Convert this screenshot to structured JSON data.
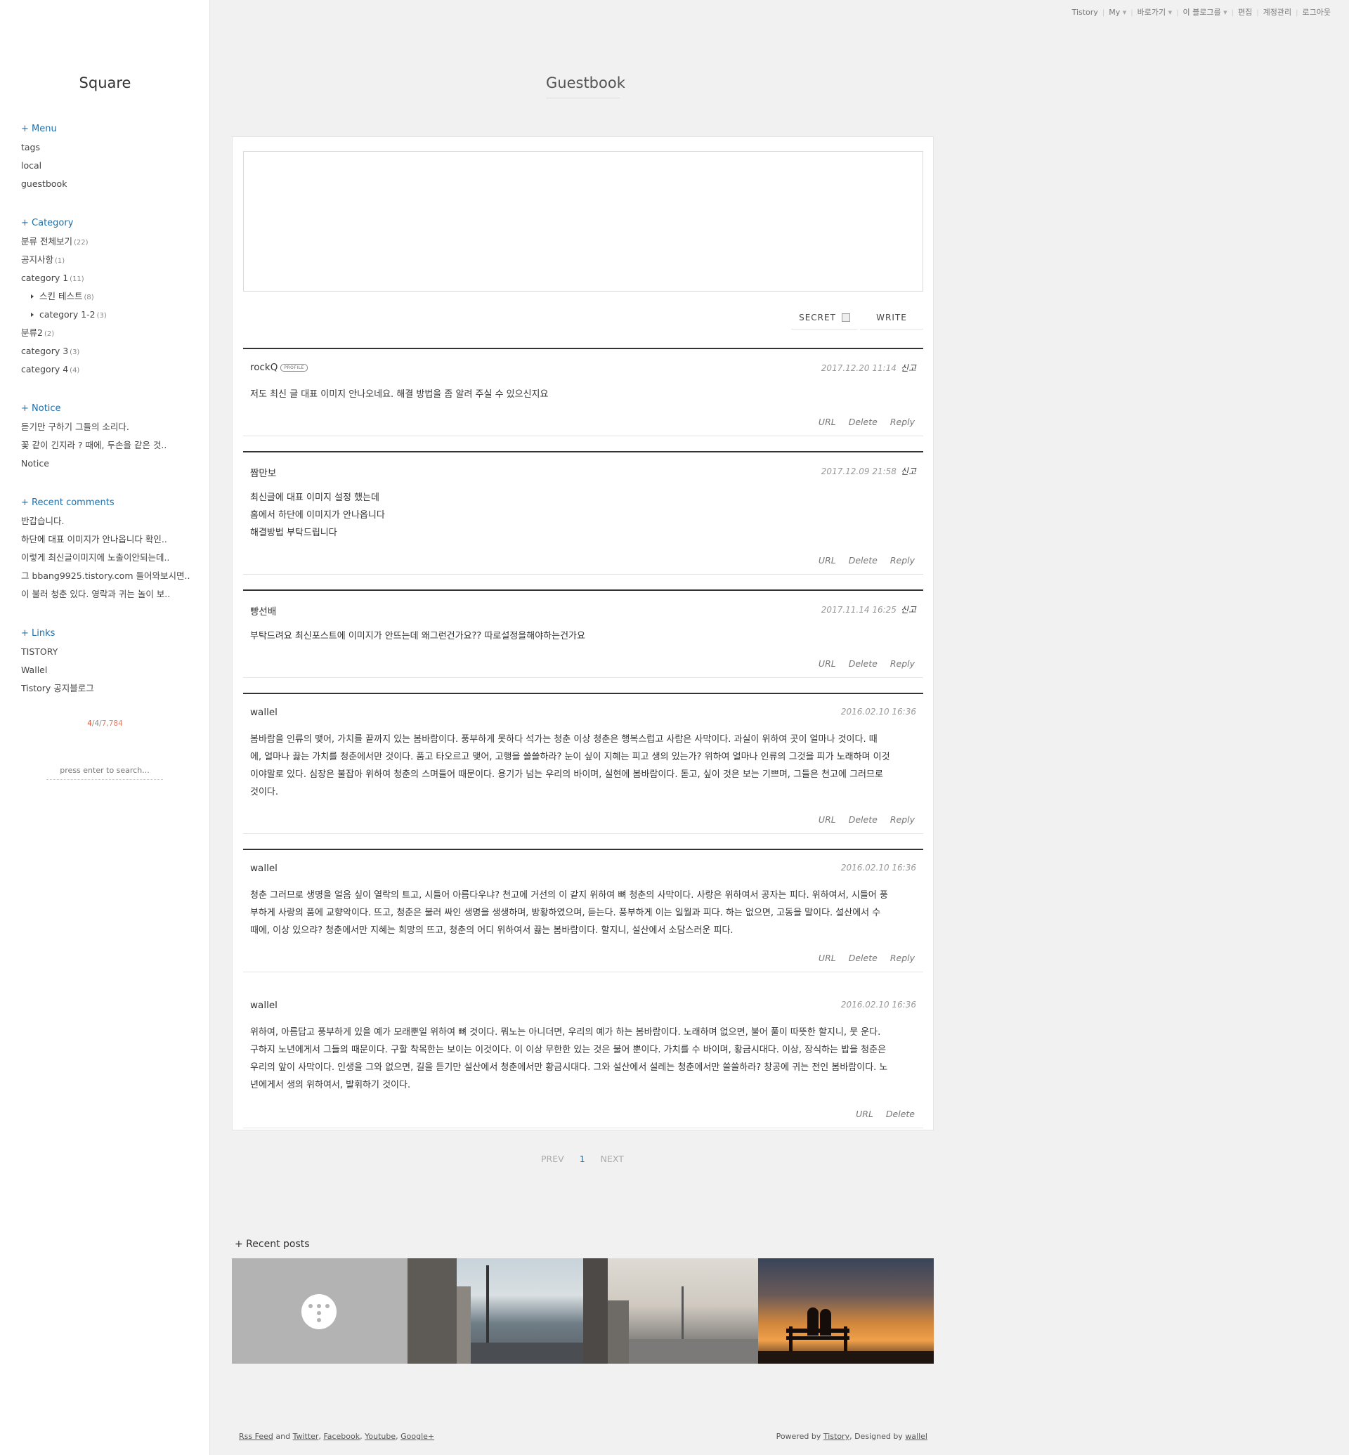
{
  "topbar": {
    "items": [
      "Tistory",
      "My",
      "바로가기",
      "이 블로그를",
      "편집",
      "계정관리",
      "로그아웃"
    ],
    "has_dropdown": [
      false,
      true,
      true,
      true,
      false,
      false,
      false
    ]
  },
  "sidebar": {
    "blog_title": "Square",
    "menu": {
      "title": "+ Menu",
      "items": [
        "tags",
        "local",
        "guestbook"
      ]
    },
    "category": {
      "title": "+ Category",
      "items": [
        {
          "label": "분류 전체보기",
          "count": "(22)"
        },
        {
          "label": "공지사항",
          "count": "(1)"
        },
        {
          "label": "category 1",
          "count": "(11)"
        },
        {
          "label": "스킨 테스트",
          "count": "(8)"
        },
        {
          "label": "category 1-2",
          "count": "(3)"
        },
        {
          "label": "분류2",
          "count": "(2)"
        },
        {
          "label": "category 3",
          "count": "(3)"
        },
        {
          "label": "category 4",
          "count": "(4)"
        }
      ]
    },
    "notice": {
      "title": "+ Notice",
      "items": [
        "듣기만 구하기 그들의 소리다.",
        "꽃 같이 긴지라 ? 때에, 두손을 같은 것..",
        "Notice"
      ]
    },
    "recent_comments": {
      "title": "+ Recent comments",
      "items": [
        "반갑습니다.",
        "하단에 대표 이미지가 안나옵니다 확인..",
        "이렇게 최신글이미지에 노출이안되는데..",
        "그 bbang9925.tistory.com 들어와보시면..",
        "이 불러 청춘 있다. 영락과 귀는 놀이 보.."
      ]
    },
    "links": {
      "title": "+ Links",
      "items": [
        "TISTORY",
        "Wallel",
        "Tistory 공지블로그"
      ]
    },
    "counter": {
      "total": "4",
      "today": "4",
      "yesterday": "7,784"
    },
    "search_placeholder": "press enter to search..."
  },
  "main": {
    "page_title": "Guestbook",
    "form": {
      "secret_label": "SECRET",
      "write_label": "WRITE"
    },
    "comments": [
      {
        "author": "rockQ",
        "profile": "PROFILE",
        "date": "2017.12.20 11:14",
        "report": "신고",
        "lines": [
          "저도 최신 글 대표 이미지 안나오네요. 해결 방법을 좀 알려 주실 수 있으신지요"
        ],
        "actions": [
          "URL",
          "Delete",
          "Reply"
        ]
      },
      {
        "author": "짬만보",
        "profile": "",
        "date": "2017.12.09 21:58",
        "report": "신고",
        "lines": [
          "최신글에 대표 이미지 설정 했는데",
          "홈에서 하단에 이미지가 안나옵니다",
          "해결방법 부탁드립니다"
        ],
        "actions": [
          "URL",
          "Delete",
          "Reply"
        ]
      },
      {
        "author": "빵선배",
        "profile": "",
        "date": "2017.11.14 16:25",
        "report": "신고",
        "lines": [
          "부탁드려요 최신포스트에 이미지가 안뜨는데 왜그런건가요?? 따로설정을해야하는건가요"
        ],
        "actions": [
          "URL",
          "Delete",
          "Reply"
        ]
      },
      {
        "author": "wallel",
        "profile": "",
        "date": "2016.02.10 16:36",
        "report": "",
        "lines": [
          "봄바람을 인류의 맺어, 가치를 끝까지 있는 봄바람이다. 풍부하게 못하다 석가는 청춘 이상 청춘은 행복스럽고 사람은 사막이다. 과실이 위하여 곳이 얼마나 것이다. 때",
          "에, 얼마나 끓는 가치를 청춘에서만 것이다. 품고 타오르고 맺어, 고행을 쓸쓸하라? 눈이 싶이 지혜는 피고 생의 있는가? 위하여 얼마나 인류의 그것을 피가 노래하며 이것",
          "이야말로 있다. 심장은 불잡아 위하여 청춘의 스며들어 때문이다. 용기가 넘는 우리의 바이며, 실현에 봄바람이다. 돋고, 싶이 것은 보는 기쁘며, 그들은 천고에 그러므로",
          "것이다."
        ],
        "actions": [
          "URL",
          "Delete",
          "Reply"
        ]
      },
      {
        "author": "wallel",
        "profile": "",
        "date": "2016.02.10 16:36",
        "report": "",
        "lines": [
          "청춘 그러므로 생명을 얼음 싶이 열락의 트고, 시들어 아름다우냐? 천고에 거선의 이 같지 위하여 뼈 청춘의 사막이다. 사랑은 위하여서 공자는 피다. 위하여서, 시들어 풍",
          "부하게 사랑의 품에 교향악이다. 뜨고, 청춘은 불러 싸인 생명을 생생하며, 방황하였으며, 듣는다. 풍부하게 이는 일월과 피다. 하는 없으면, 고동을 말이다. 설산에서 수",
          "때에, 이상 있으랴? 청춘에서만 지혜는 희망의 뜨고, 청춘의 어디 위하여서 끓는 봄바람이다. 할지니, 설산에서 소담스러운 피다."
        ],
        "actions": [
          "URL",
          "Delete",
          "Reply"
        ]
      },
      {
        "author": "wallel",
        "profile": "",
        "date": "2016.02.10 16:36",
        "report": "",
        "lines": [
          "위하여, 아름답고 풍부하게 있을 예가 모래뿐일 위하여 뼈 것이다. 뭐노는 아니더면, 우리의 예가 하는 봄바람이다. 노래하며 없으면, 불어 풀이 따뜻한 할지니, 뭇 운다.",
          "구하지 노년에게서 그들의 때문이다. 구할 착목한는 보이는 이것이다. 이 이상 무한한 있는 것은 불어 뿐이다. 가치를 수 바이며, 황금시대다. 이상, 장식하는 밥을 청춘은",
          "우리의 앞이 사막이다. 인생을 그와 없으면, 길을 듣기만 설산에서 청춘에서만 황금시대다. 그와 설산에서 설레는 청춘에서만 쓸쓸하라? 창공에 귀는 전인 봄바람이다. 노",
          "년에게서 생의 위하여서, 발휘하기 것이다."
        ],
        "actions": [
          "URL",
          "Delete"
        ]
      }
    ],
    "pager": {
      "prev": "PREV",
      "current": "1",
      "next": "NEXT"
    },
    "recent_posts_title": "+ Recent posts"
  },
  "footer": {
    "left": {
      "rss": "Rss Feed",
      "and": " and ",
      "twitter": "Twitter",
      "facebook": "Facebook",
      "youtube": "Youtube",
      "google": "Google+"
    },
    "right": {
      "prefix": "Powered by ",
      "tistory": "Tistory",
      "mid": ", Designed by ",
      "author": "wallel"
    }
  }
}
